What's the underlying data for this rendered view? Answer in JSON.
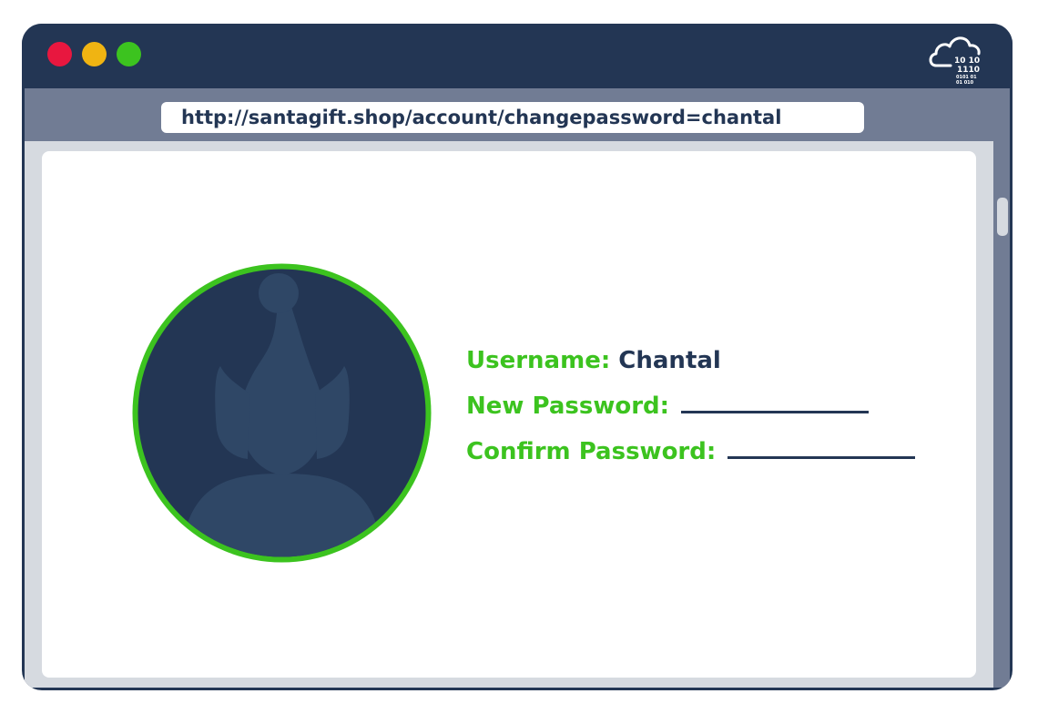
{
  "browser": {
    "window_controls": [
      "close",
      "minimize",
      "maximize"
    ],
    "logo_icon": "cloud-binary-icon",
    "logo_text": [
      "10 10",
      "1110",
      "0101 01",
      "01 010"
    ],
    "url": "http://santagift.shop/account/changepassword=chantal"
  },
  "colors": {
    "frame": "#233654",
    "address_area": "#717c94",
    "content_bg": "#d6dae0",
    "accent_green": "#3cc31f",
    "close": "#e8173f",
    "minimize": "#f0b412",
    "maximize": "#3cc31f"
  },
  "form": {
    "avatar_icon": "elf-silhouette-icon",
    "username_label": "Username:",
    "username_value": "Chantal",
    "new_password_label": "New Password:",
    "confirm_password_label": "Confirm Password:"
  }
}
